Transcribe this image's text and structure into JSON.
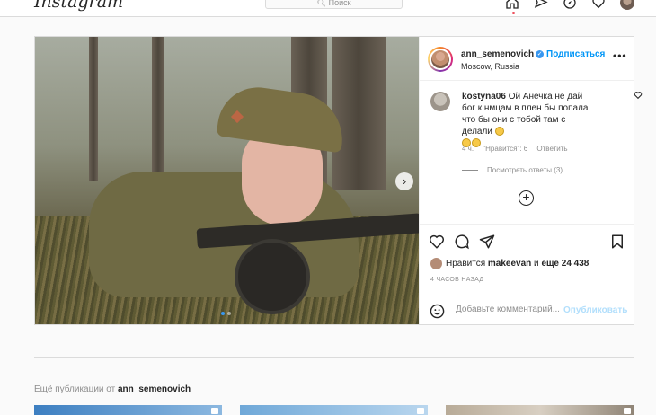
{
  "topbar": {
    "logo": "Instagram",
    "search_placeholder": "Поиск",
    "icons": [
      "home-icon",
      "direct-icon",
      "explore-icon",
      "activity-heart-icon",
      "profile-avatar-icon"
    ]
  },
  "post": {
    "author": {
      "username": "ann_semenovich",
      "verified": true,
      "follow_label": "Подписаться",
      "location": "Moscow, Russia"
    },
    "more_label": "•••",
    "comment": {
      "username": "kostyna06",
      "text": "Ой Анечка не дай бог к нмцам в плен бы попала что бы они с тобой там с делали",
      "time": "4 ч.",
      "likes": "\"Нравится\": 6",
      "reply_label": "Ответить",
      "view_replies": "Посмотреть ответы (3)"
    },
    "likes_line": {
      "prefix": "Нравится ",
      "user": "makeevan",
      "middle": " и ",
      "others": "ещё 24 438"
    },
    "timestamp": "4 ЧАСОВ НАЗАД",
    "comment_placeholder": "Добавьте комментарий...",
    "publish_label": "Опубликовать",
    "carousel": {
      "current": 1,
      "total": 2
    }
  },
  "more_posts": {
    "prefix": "Ещё публикации от ",
    "username": "ann_semenovich"
  },
  "colors": {
    "accent": "#0095f6",
    "verified": "#3897f0",
    "border": "#dbdbdb",
    "muted": "#8e8e8e",
    "publish_disabled": "#b2dffc"
  }
}
